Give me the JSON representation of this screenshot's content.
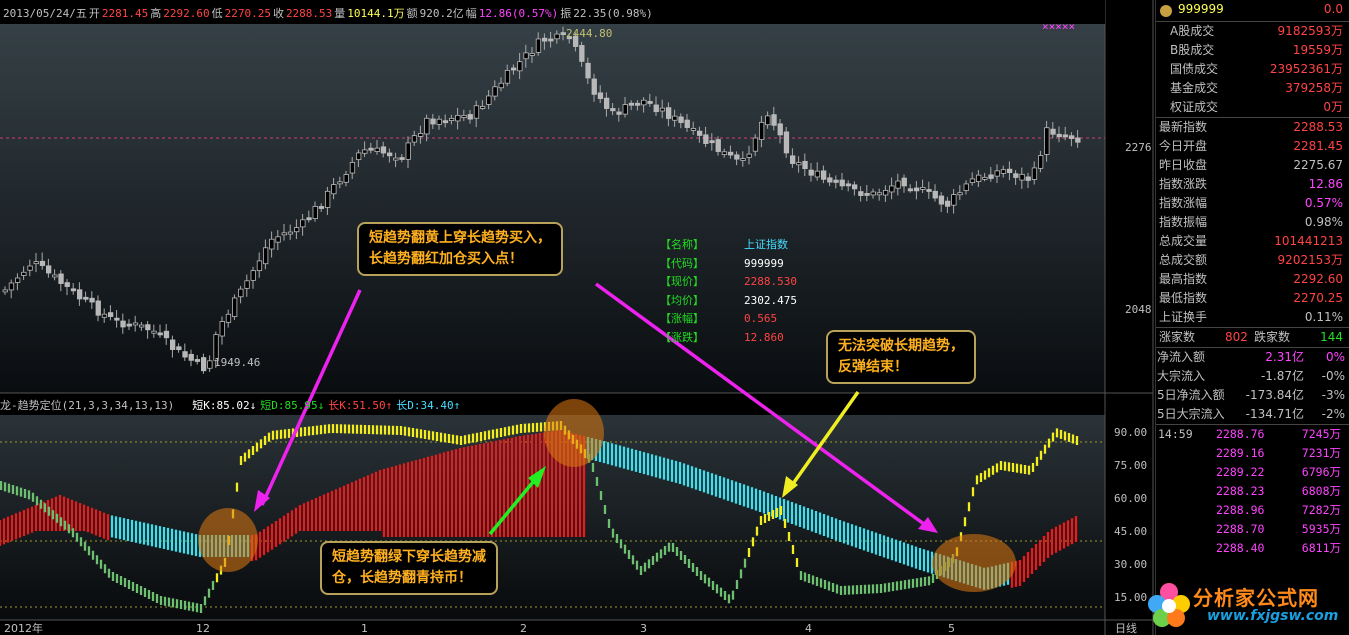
{
  "topbar": {
    "date": "2013/05/24/五",
    "open_label": "开",
    "open": "2281.45",
    "high_label": "高",
    "high": "2292.60",
    "low_label": "低",
    "low": "2270.25",
    "close_label": "收",
    "close": "2288.53",
    "volume_label": "量",
    "volume": "10144.1万",
    "amount_label": "额",
    "amount": "920.2亿",
    "range_label": "幅",
    "range": "12.86(0.57%)",
    "swing_label": "振",
    "swing": "22.35(0.98%)",
    "markers": "×××××"
  },
  "price_chart": {
    "high_mark": "2444.80",
    "low_mark": "1949.46",
    "axis": {
      "y_top": "2276",
      "y_bottom": "2048"
    },
    "reference_line": 2276
  },
  "info": {
    "rows": [
      {
        "key": "【名称】",
        "val": "上证指数",
        "color": "#44ddff"
      },
      {
        "key": "【代码】",
        "val": "999999",
        "color": "#ffffff"
      },
      {
        "key": "【现价】",
        "val": "2288.530",
        "color": "#ff4444"
      },
      {
        "key": "【均价】",
        "val": "2302.475",
        "color": "#ffffff"
      },
      {
        "key": "【涨幅】",
        "val": "0.565",
        "color": "#ff4444"
      },
      {
        "key": "【涨跌】",
        "val": "12.860",
        "color": "#ff4444"
      }
    ]
  },
  "indicator": {
    "name": "龙-趋势定位(21,3,3,34,13,13)",
    "sk_label": "短K:",
    "sk": "85.02↓",
    "sd_label": "短D:",
    "sd": "85.95↓",
    "lk_label": "长K:",
    "lk": "51.50↑",
    "ld_label": "长D:",
    "ld": "34.40↑",
    "y_ticks": [
      "90.00",
      "75.00",
      "60.00",
      "45.00",
      "30.00",
      "15.00"
    ]
  },
  "x_axis": {
    "labels": [
      "2012年",
      "12",
      "1",
      "2",
      "3",
      "4",
      "5"
    ],
    "period": "日线"
  },
  "callouts": {
    "buy": [
      "短趋势翻黄上穿长趋势买入，",
      "长趋势翻红加仓买入点！"
    ],
    "sell": [
      "短趋势翻绿下穿长趋势减",
      "仓，长趋势翻青持币！"
    ],
    "end": [
      "无法突破长期趋势，",
      "反弹结束！"
    ]
  },
  "right_panel": {
    "header": "999999",
    "header_val": "0.0",
    "volume_rows": [
      {
        "label": "A股成交",
        "value": "9182593万"
      },
      {
        "label": "B股成交",
        "value": "19559万"
      },
      {
        "label": "国债成交",
        "value": "23952361万"
      },
      {
        "label": "基金成交",
        "value": "379258万"
      },
      {
        "label": "权证成交",
        "value": "0万"
      }
    ],
    "stat_rows": [
      {
        "label": "最新指数",
        "value": "2288.53",
        "color": "#ff4444"
      },
      {
        "label": "今日开盘",
        "value": "2281.45",
        "color": "#ff4444"
      },
      {
        "label": "昨日收盘",
        "value": "2275.67",
        "color": "#c0c0c0"
      },
      {
        "label": "指数涨跌",
        "value": "12.86",
        "color": "#ff44ff"
      },
      {
        "label": "指数涨幅",
        "value": "0.57%",
        "color": "#ff44ff"
      },
      {
        "label": "指数振幅",
        "value": "0.98%",
        "color": "#c0c0c0"
      },
      {
        "label": "总成交量",
        "value": "101441213",
        "color": "#ff4444"
      },
      {
        "label": "总成交额",
        "value": "9202153万",
        "color": "#ff4444"
      },
      {
        "label": "最高指数",
        "value": "2292.60",
        "color": "#ff4444"
      },
      {
        "label": "最低指数",
        "value": "2270.25",
        "color": "#ff4444"
      },
      {
        "label": "上证换手",
        "value": "0.11%",
        "color": "#c0c0c0"
      }
    ],
    "updown": {
      "up_label": "涨家数",
      "up": "802",
      "down_label": "跌家数",
      "down": "144"
    },
    "flow_rows": [
      {
        "label": "净流入额",
        "value": "2.31亿",
        "pct": "0%",
        "vcolor": "#ff44ff",
        "pcolor": "#ff44ff"
      },
      {
        "label": "大宗流入",
        "value": "-1.87亿",
        "pct": "-0%",
        "vcolor": "#c0c0c0",
        "pcolor": "#c0c0c0"
      },
      {
        "label": "5日净流入额",
        "value": "-173.84亿",
        "pct": "-3%",
        "vcolor": "#c0c0c0",
        "pcolor": "#c0c0c0"
      },
      {
        "label": "5日大宗流入",
        "value": "-134.71亿",
        "pct": "-2%",
        "vcolor": "#c0c0c0",
        "pcolor": "#c0c0c0"
      }
    ],
    "ticks": [
      {
        "time": "14:59",
        "price": "2288.76",
        "qty": "7245万"
      },
      {
        "time": "",
        "price": "2289.16",
        "qty": "7231万"
      },
      {
        "time": "",
        "price": "2289.22",
        "qty": "6796万"
      },
      {
        "time": "",
        "price": "2288.23",
        "qty": "6808万"
      },
      {
        "time": "",
        "price": "2288.96",
        "qty": "7282万"
      },
      {
        "time": "",
        "price": "2288.70",
        "qty": "5935万"
      },
      {
        "time": "",
        "price": "2288.40",
        "qty": "6811万"
      }
    ]
  },
  "watermark": {
    "title": "分析家公式网",
    "url": "www.fxjgsw.com"
  }
}
